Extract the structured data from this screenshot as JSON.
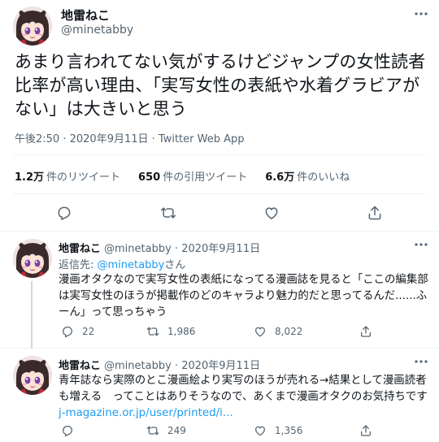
{
  "main_tweet": {
    "display_name": "地雷ねこ",
    "handle": "@minetabby",
    "more_icon": "more-horizontal-icon",
    "text": "あまり言われてない気がするけどジャンプの女性読者比率が高い理由、「実写女性の表紙や水着グラビアがない」は大きいと思う",
    "time": "午後2:50",
    "date": "2020年9月11日",
    "source": "Twitter Web App",
    "separator": " · ",
    "stats": {
      "retweets_count": "1.2万",
      "retweets_label": "件のリツイート",
      "quotes_count": "650",
      "quotes_label": "件の引用ツイート",
      "likes_count": "6.6万",
      "likes_label": "件のいいね"
    },
    "actions": [
      "reply-icon",
      "retweet-icon",
      "like-icon",
      "share-icon"
    ]
  },
  "replies": [
    {
      "display_name": "地雷ねこ",
      "handle": "@minetabby",
      "date": "2020年9月11日",
      "separator": " · ",
      "replying_label": "返信先: ",
      "replying_to": "@minetabby",
      "replying_suffix": "さん",
      "text": "漫画オタクなので実写女性の表紙になってる漫画誌を見ると「ここの編集部は実写女性のほうが掲載作のどのキャラより魅力的だと思ってるんだ......ふーん」って思っちゃう",
      "reply_count": "22",
      "retweet_count": "1,986",
      "like_count": "8,022"
    },
    {
      "display_name": "地雷ねこ",
      "handle": "@minetabby",
      "date": "2020年9月11日",
      "separator": " · ",
      "text": "青年誌なら実際のとこ漫画絵より実写のほうが売れる→結果として漫画読者も増える　ってことはありそうなので、あくまで漫画オタクのお気持ちです ",
      "link": "j-magazine.or.jp/user/printed/i...",
      "reply_count": "",
      "retweet_count": "249",
      "like_count": "1,356"
    }
  ],
  "colors": {
    "text": "#0f1419",
    "secondary": "#536471",
    "link": "#1d9bf0",
    "border": "#eff3f4"
  }
}
